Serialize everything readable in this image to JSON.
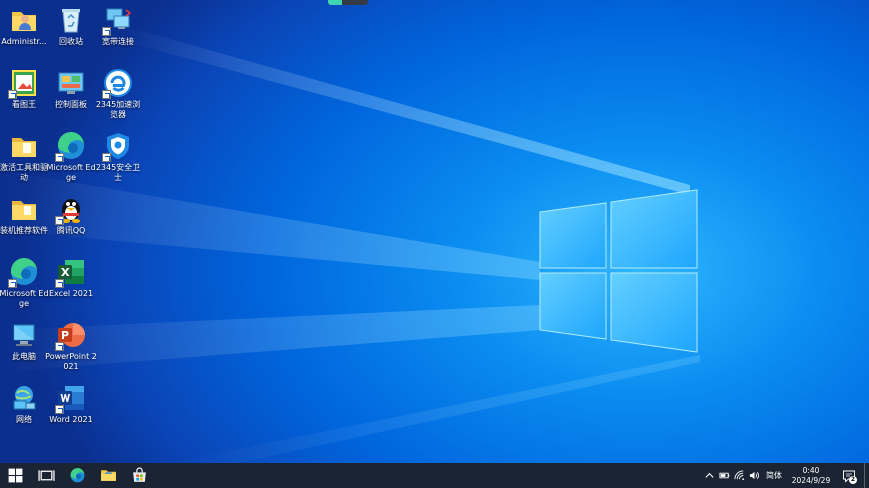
{
  "desktop": {
    "icons": [
      {
        "name": "administrator-folder",
        "label": "Administr..."
      },
      {
        "name": "recycle-bin",
        "label": "回收站"
      },
      {
        "name": "broadband-connection",
        "label": "宽带连接"
      },
      {
        "name": "kantu-wang",
        "label": "看图王"
      },
      {
        "name": "control-panel",
        "label": "控制面板"
      },
      {
        "name": "browser-2345",
        "label": "2345加速浏览器"
      },
      {
        "name": "activation-tools",
        "label": "激活工具和驱动"
      },
      {
        "name": "edge-1",
        "label": "Microsoft Edge"
      },
      {
        "name": "security-2345",
        "label": "2345安全卫士"
      },
      {
        "name": "recommended-software",
        "label": "装机推荐软件"
      },
      {
        "name": "tencent-qq",
        "label": "腾讯QQ"
      },
      {
        "name": "edge-2",
        "label": "Microsoft Edge"
      },
      {
        "name": "excel-2021",
        "label": "Excel 2021"
      },
      {
        "name": "this-pc",
        "label": "此电脑"
      },
      {
        "name": "powerpoint-2021",
        "label": "PowerPoint 2021"
      },
      {
        "name": "network",
        "label": "网络"
      },
      {
        "name": "word-2021",
        "label": "Word 2021"
      }
    ]
  },
  "top_progress": {
    "value": 0.35,
    "color": "#3fd4b4"
  },
  "taskbar": {
    "pinned": [
      "start-icon",
      "task-view-icon",
      "edge-icon",
      "file-explorer-icon",
      "store-icon"
    ],
    "tray": {
      "ime": "简体",
      "time": "0:40",
      "date": "2024/9/29",
      "notification_count": "2"
    }
  },
  "colors": {
    "taskbar": "#1a2433",
    "wallpaper_blue": "#0a6ee0"
  }
}
